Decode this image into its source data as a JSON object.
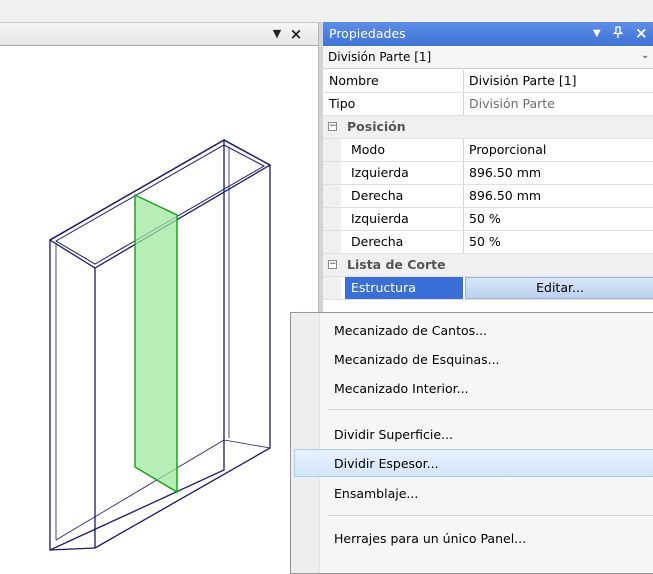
{
  "viewport": {
    "close_glyph": "×",
    "dropdown_glyph": "▼"
  },
  "properties_panel": {
    "title": "Propiedades",
    "pin_glyph": "⊿",
    "dropdown_glyph": "▼",
    "close_glyph": "×",
    "object_selector": {
      "value": "División Parte [1]",
      "arrow": "⌄"
    },
    "rows": {
      "nombre": {
        "label": "Nombre",
        "value": "División Parte [1]"
      },
      "tipo": {
        "label": "Tipo",
        "value": "División Parte"
      },
      "posicion": {
        "label": "Posición",
        "expander": "−"
      },
      "modo": {
        "label": "Modo",
        "value": "Proporcional"
      },
      "izquierda_mm": {
        "label": "Izquierda",
        "value": "896.50 mm"
      },
      "derecha_mm": {
        "label": "Derecha",
        "value": "896.50 mm"
      },
      "izquierda_pct": {
        "label": "Izquierda",
        "value": "50 %"
      },
      "derecha_pct": {
        "label": "Derecha",
        "value": "50 %"
      },
      "lista_corte": {
        "label": "Lista de Corte",
        "expander": "−"
      },
      "estructura": {
        "label": "Estructura",
        "button": "Editar..."
      }
    }
  },
  "context_menu": {
    "items": [
      "Mecanizado de Cantos...",
      "Mecanizado de Esquinas...",
      "Mecanizado Interior...",
      "Dividir Superficie...",
      "Dividir Espesor...",
      "Ensamblaje...",
      "Herrajes para un único Panel..."
    ],
    "highlighted_index": 4
  },
  "colors": {
    "title_bar": "#4a7edf",
    "selection": "#3a6fd8",
    "model_edges": "#1a1a6e",
    "division_fill": "#9ee89e",
    "division_stroke": "#1ba31b"
  }
}
